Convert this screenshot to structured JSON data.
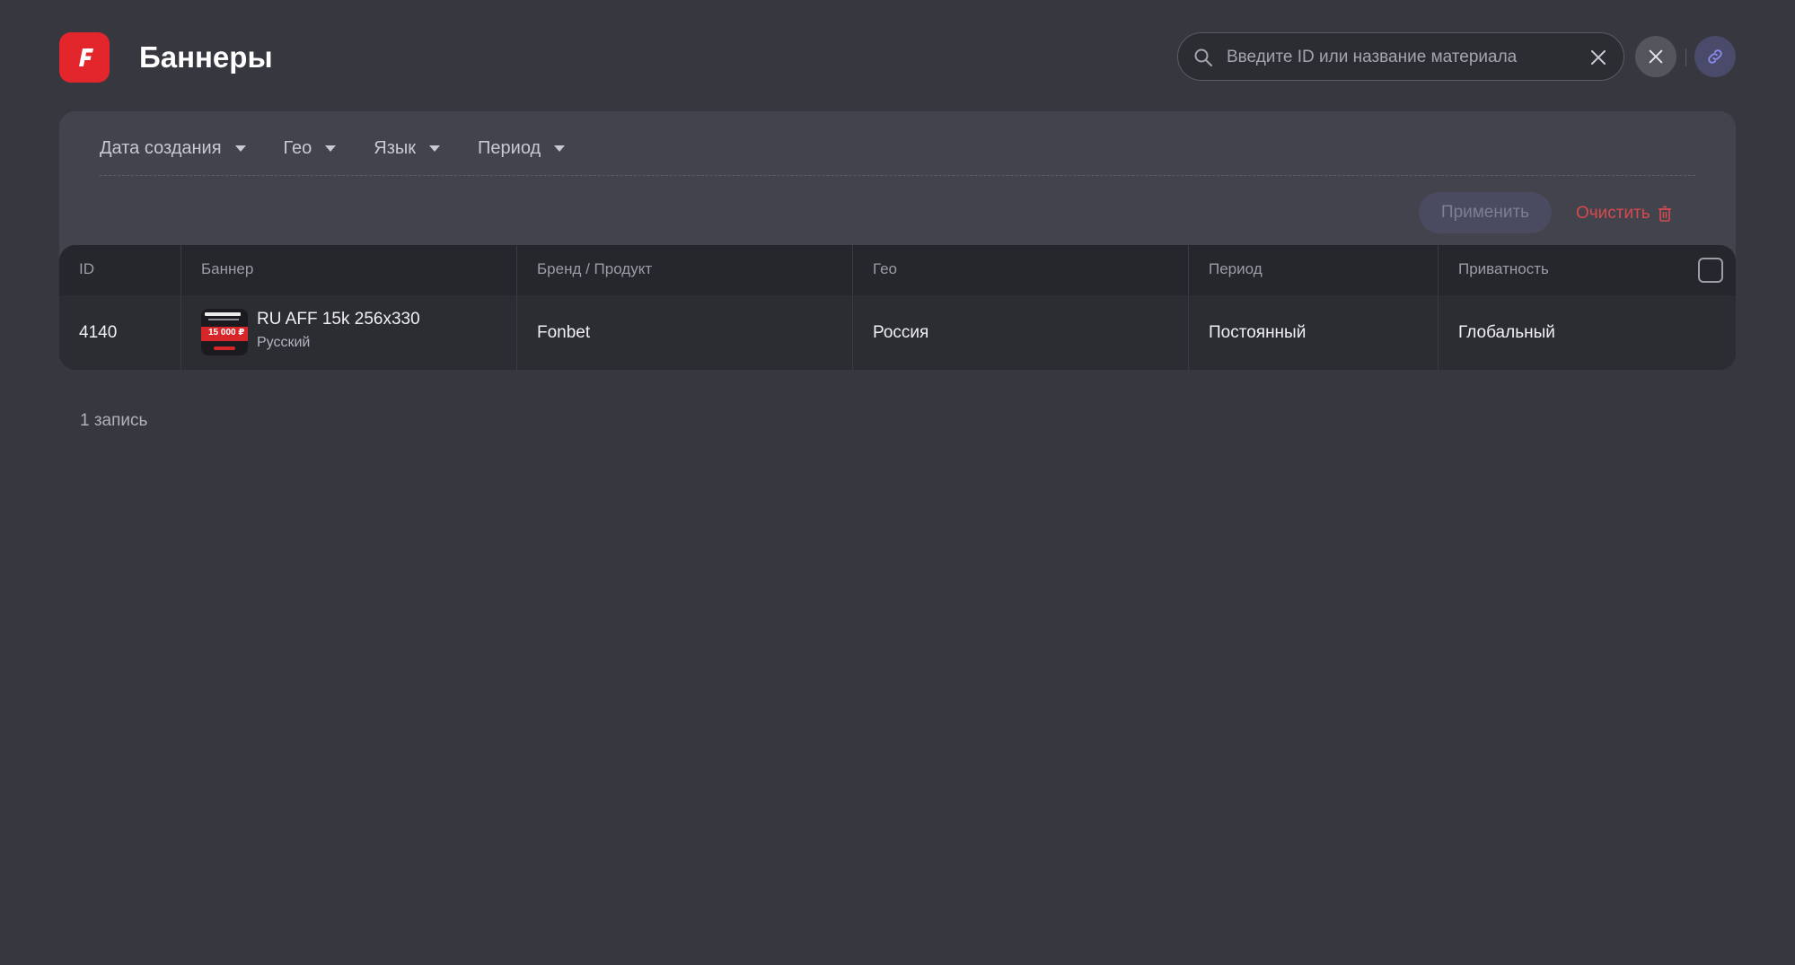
{
  "header": {
    "logo_letter": "F",
    "title": "Баннеры",
    "search": {
      "placeholder": "Введите ID или название материала",
      "value": ""
    }
  },
  "filters": {
    "items": [
      {
        "label": "Дата создания"
      },
      {
        "label": "Гео"
      },
      {
        "label": "Язык"
      },
      {
        "label": "Период"
      }
    ],
    "apply_label": "Применить",
    "clear_label": "Очистить"
  },
  "table": {
    "columns": [
      "ID",
      "Баннер",
      "Бренд / Продукт",
      "Гео",
      "Период",
      "Приватность"
    ],
    "rows": [
      {
        "id": "4140",
        "banner_name": "RU AFF 15k 256x330",
        "banner_lang": "Русский",
        "thumb_amount": "15 000 ₽",
        "brand": "Fonbet",
        "geo": "Россия",
        "period": "Постоянный",
        "privacy": "Глобальный"
      }
    ]
  },
  "footer": {
    "count_label": "1 запись"
  },
  "colors": {
    "brand": "#e3262b",
    "danger": "#d84a4c",
    "background": "#37383f"
  },
  "icons": [
    "fonbet-logo-icon",
    "search-icon",
    "clear-icon",
    "close-icon",
    "link-icon",
    "chevron-down-icon",
    "trash-icon"
  ]
}
